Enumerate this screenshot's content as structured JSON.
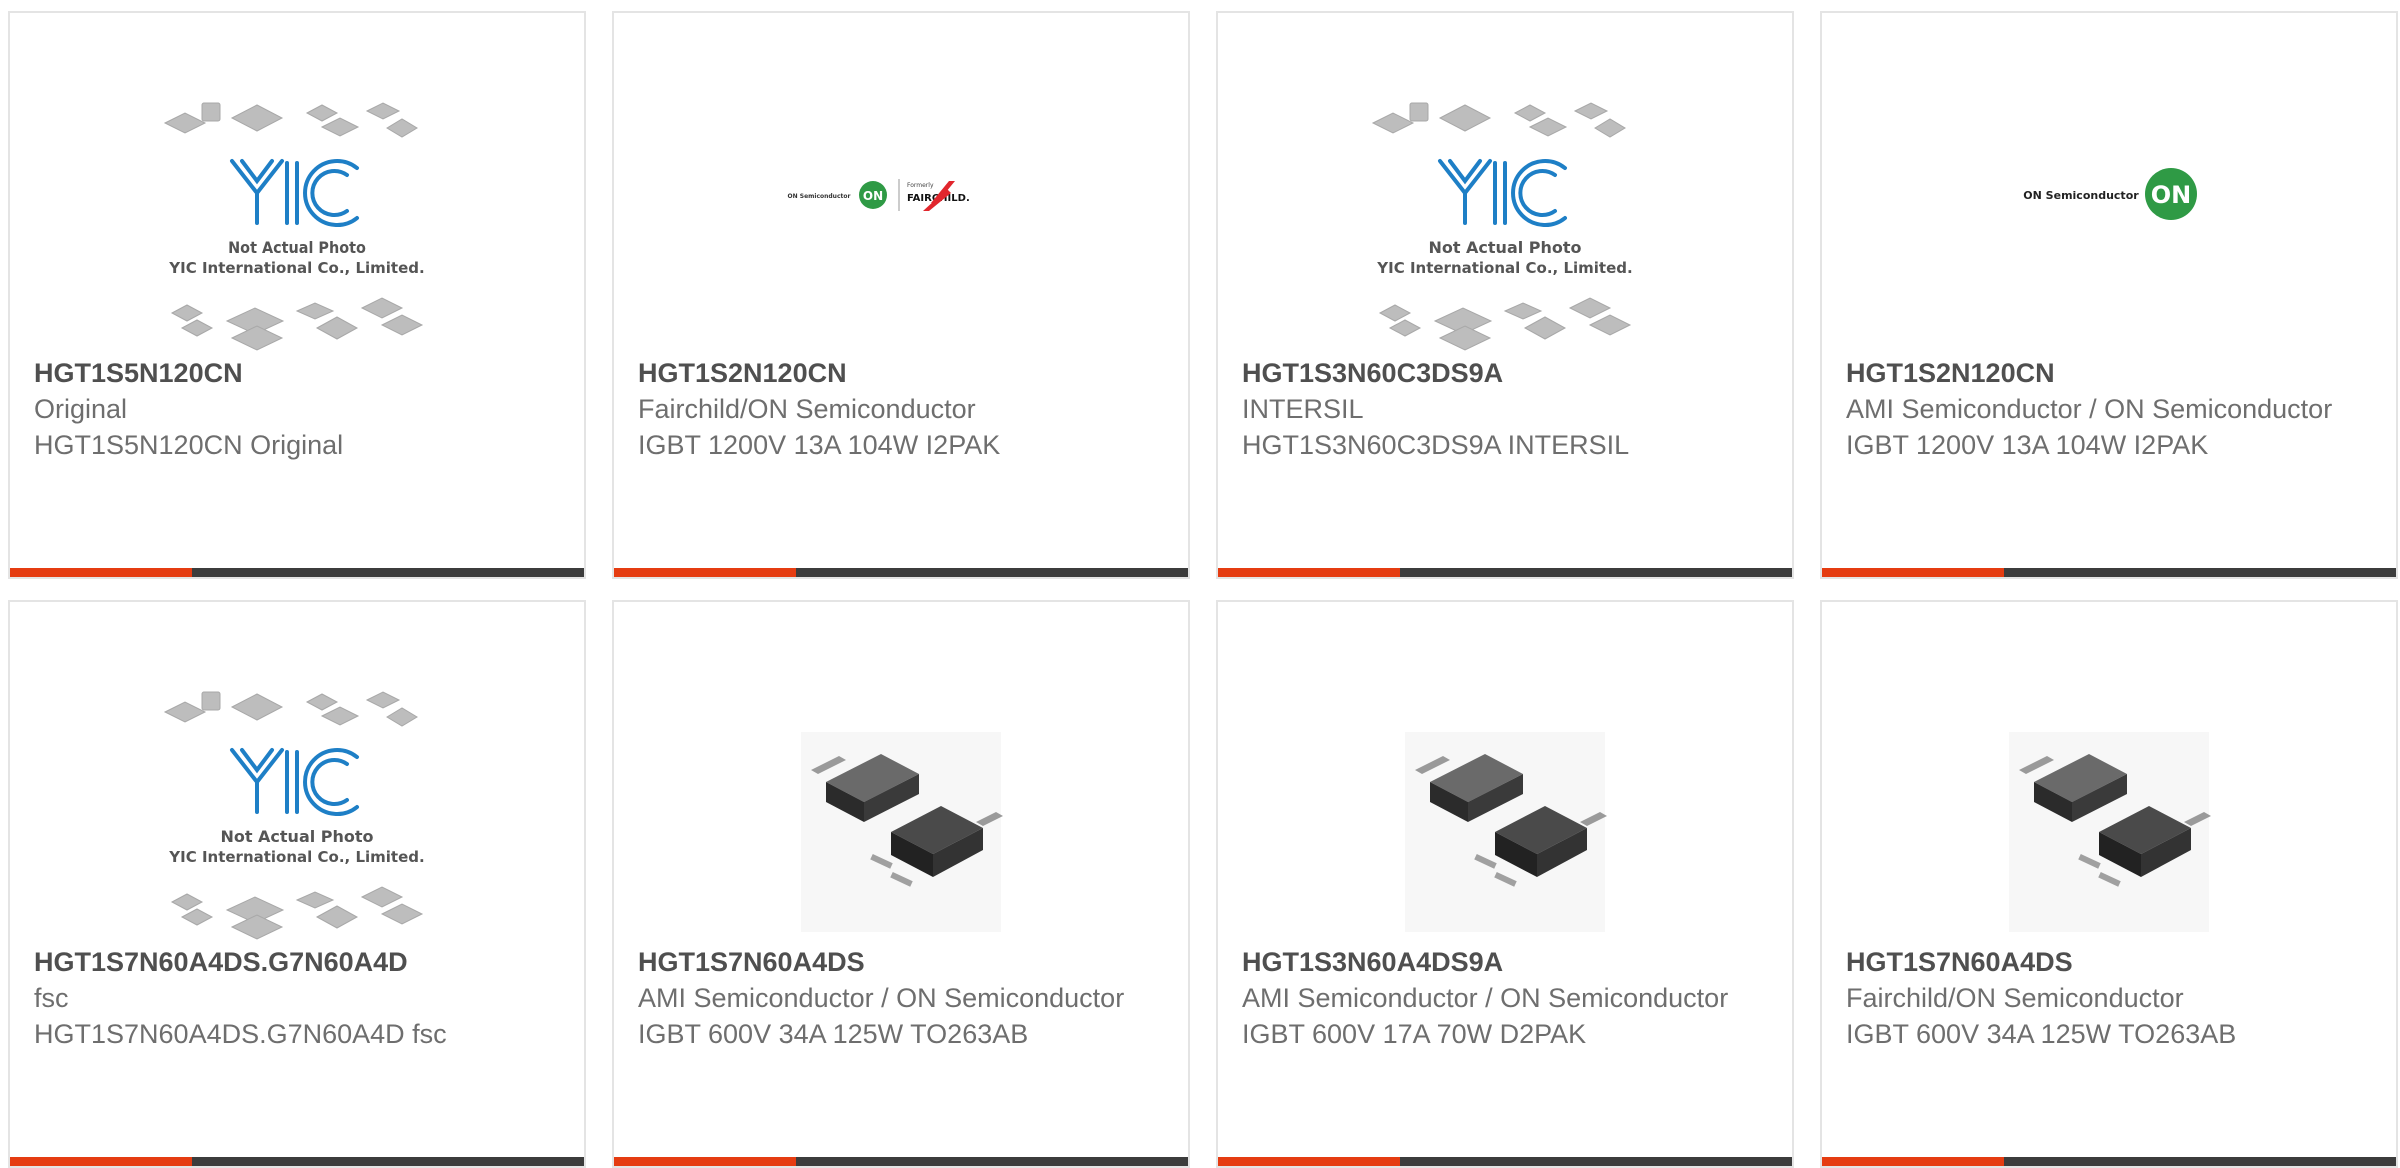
{
  "colors": {
    "accent": "#e53c11",
    "bar_dark": "#3c3c3c",
    "yic_blue": "#1e7fc6",
    "on_green": "#2f9a45",
    "fairchild_red": "#e1262d"
  },
  "products": [
    {
      "part_number": "HGT1S5N120CN",
      "manufacturer": "Original",
      "description": "HGT1S5N120CN Original",
      "image": "yic-placeholder",
      "yic_note_1": "Not Actual Photo",
      "yic_note_2": "YIC International Co., Limited."
    },
    {
      "part_number": "HGT1S2N120CN",
      "manufacturer": "Fairchild/ON Semiconductor",
      "description": "IGBT 1200V 13A 104W I2PAK",
      "image": "on-fairchild-logo",
      "logo_text_on": "ON Semiconductor",
      "logo_text_formerly": "Formerly",
      "logo_text_fairchild": "FAIRCHILD."
    },
    {
      "part_number": "HGT1S3N60C3DS9A",
      "manufacturer": "INTERSIL",
      "description": "HGT1S3N60C3DS9A INTERSIL",
      "image": "yic-placeholder",
      "yic_note_1": "Not Actual Photo",
      "yic_note_2": "YIC International Co., Limited."
    },
    {
      "part_number": "HGT1S2N120CN",
      "manufacturer": "AMI Semiconductor / ON Semiconductor",
      "description": "IGBT 1200V 13A 104W I2PAK",
      "image": "on-logo",
      "logo_text_on": "ON Semiconductor"
    },
    {
      "part_number": "HGT1S7N60A4DS.G7N60A4D",
      "manufacturer": "fsc",
      "description": "HGT1S7N60A4DS.G7N60A4D fsc",
      "image": "yic-placeholder",
      "yic_note_1": "Not Actual Photo",
      "yic_note_2": "YIC International Co., Limited."
    },
    {
      "part_number": "HGT1S7N60A4DS",
      "manufacturer": "AMI Semiconductor / ON Semiconductor",
      "description": "IGBT 600V 34A 125W TO263AB",
      "image": "d2pak-photo"
    },
    {
      "part_number": "HGT1S3N60A4DS9A",
      "manufacturer": "AMI Semiconductor / ON Semiconductor",
      "description": "IGBT 600V 17A 70W D2PAK",
      "image": "d2pak-photo"
    },
    {
      "part_number": "HGT1S7N60A4DS",
      "manufacturer": "Fairchild/ON Semiconductor",
      "description": "IGBT 600V 34A 125W TO263AB",
      "image": "d2pak-photo"
    }
  ]
}
